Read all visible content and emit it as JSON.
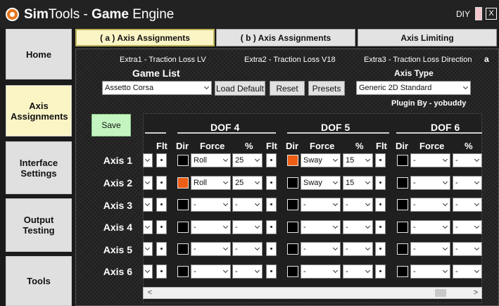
{
  "window": {
    "title_brand_bold": "Sim",
    "title_brand_rest": "Tools - ",
    "title_section_bold": "Game",
    "title_section_rest": " Engine",
    "diy_label": "DIY",
    "close_label": "X"
  },
  "nav": [
    {
      "label": "Home",
      "active": false
    },
    {
      "label": "Axis Assignments",
      "active": true
    },
    {
      "label": "Interface Settings",
      "active": false
    },
    {
      "label": "Output Testing",
      "active": false
    },
    {
      "label": "Tools",
      "active": false
    }
  ],
  "tabs": [
    {
      "label": "( a ) Axis Assignments",
      "active": true
    },
    {
      "label": "( b ) Axis Assignments",
      "active": false
    },
    {
      "label": "Axis Limiting",
      "active": false
    }
  ],
  "extras": [
    "Extra1 - Traction Loss LV",
    "Extra2 - Traction Loss V18",
    "Extra3 - Traction Loss Direction"
  ],
  "corner_label": "a",
  "game_list": {
    "label": "Game List",
    "value": "Assetto Corsa"
  },
  "buttons": {
    "load_default": "Load Default",
    "reset": "Reset",
    "presets": "Presets",
    "save": "Save"
  },
  "axis_type": {
    "label": "Axis Type",
    "value": "Generic 2D Standard"
  },
  "plugin_by": "Plugin By - yobuddy",
  "dof_headers": [
    "DOF 4",
    "DOF 5",
    "DOF 6"
  ],
  "col_headers": {
    "flt": "Flt",
    "dir": "Dir",
    "force": "Force",
    "pct": "%"
  },
  "axes": [
    {
      "label": "Axis 1",
      "dof4": {
        "dir": false,
        "force": "Roll",
        "pct": "25"
      },
      "dof5": {
        "dir": true,
        "force": "Sway",
        "pct": "15"
      },
      "dof6": {
        "dir": false,
        "force": "-",
        "pct": "-"
      }
    },
    {
      "label": "Axis 2",
      "dof4": {
        "dir": true,
        "force": "Roll",
        "pct": "25"
      },
      "dof5": {
        "dir": false,
        "force": "Sway",
        "pct": "15"
      },
      "dof6": {
        "dir": false,
        "force": "-",
        "pct": "-"
      }
    },
    {
      "label": "Axis 3",
      "dof4": {
        "dir": false,
        "force": "-",
        "pct": "-"
      },
      "dof5": {
        "dir": false,
        "force": "-",
        "pct": "-"
      },
      "dof6": {
        "dir": false,
        "force": "-",
        "pct": "-"
      }
    },
    {
      "label": "Axis 4",
      "dof4": {
        "dir": false,
        "force": "-",
        "pct": "-"
      },
      "dof5": {
        "dir": false,
        "force": "-",
        "pct": "-"
      },
      "dof6": {
        "dir": false,
        "force": "-",
        "pct": "-"
      }
    },
    {
      "label": "Axis 5",
      "dof4": {
        "dir": false,
        "force": "-",
        "pct": "-"
      },
      "dof5": {
        "dir": false,
        "force": "-",
        "pct": "-"
      },
      "dof6": {
        "dir": false,
        "force": "-",
        "pct": "-"
      }
    },
    {
      "label": "Axis 6",
      "dof4": {
        "dir": false,
        "force": "-",
        "pct": "-"
      },
      "dof5": {
        "dir": false,
        "force": "-",
        "pct": "-"
      },
      "dof6": {
        "dir": false,
        "force": "-",
        "pct": "-"
      }
    }
  ],
  "scrollbar": {
    "left_arrow": "<",
    "right_arrow": ">"
  },
  "colors": {
    "accent_orange": "#ee5d14",
    "active_yellow": "#fbf5c6",
    "save_green": "#c4f5c1"
  }
}
